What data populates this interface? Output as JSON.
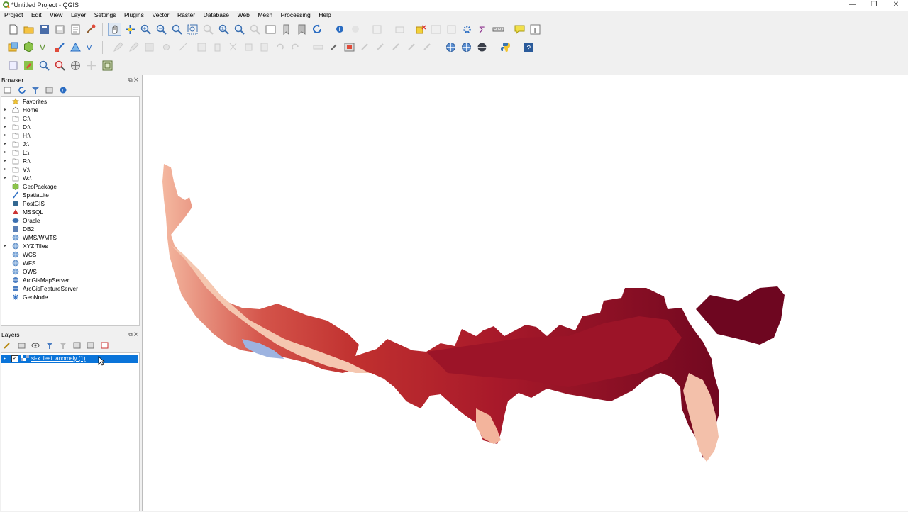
{
  "window": {
    "title": "*Untitled Project - QGIS",
    "minimize": "—",
    "restore": "❐",
    "close": "✕"
  },
  "menu": [
    "Project",
    "Edit",
    "View",
    "Layer",
    "Settings",
    "Plugins",
    "Vector",
    "Raster",
    "Database",
    "Web",
    "Mesh",
    "Processing",
    "Help"
  ],
  "browser": {
    "title": "Browser",
    "items": [
      {
        "label": "Favorites",
        "icon": "star-icon",
        "expand": false
      },
      {
        "label": "Home",
        "icon": "home-icon",
        "expand": true
      },
      {
        "label": "C:\\",
        "icon": "folder-icon",
        "expand": true
      },
      {
        "label": "D:\\",
        "icon": "folder-icon",
        "expand": true
      },
      {
        "label": "H:\\",
        "icon": "folder-icon",
        "expand": true
      },
      {
        "label": "J:\\",
        "icon": "folder-icon",
        "expand": true
      },
      {
        "label": "L:\\",
        "icon": "folder-icon",
        "expand": true
      },
      {
        "label": "R:\\",
        "icon": "folder-icon",
        "expand": true
      },
      {
        "label": "V:\\",
        "icon": "folder-icon",
        "expand": true
      },
      {
        "label": "W:\\",
        "icon": "folder-icon",
        "expand": true
      },
      {
        "label": "GeoPackage",
        "icon": "geopackage-icon",
        "expand": false
      },
      {
        "label": "SpatiaLite",
        "icon": "spatialite-icon",
        "expand": false
      },
      {
        "label": "PostGIS",
        "icon": "postgis-icon",
        "expand": false
      },
      {
        "label": "MSSQL",
        "icon": "mssql-icon",
        "expand": false
      },
      {
        "label": "Oracle",
        "icon": "oracle-icon",
        "expand": false
      },
      {
        "label": "DB2",
        "icon": "db2-icon",
        "expand": false
      },
      {
        "label": "WMS/WMTS",
        "icon": "globe-icon",
        "expand": false
      },
      {
        "label": "XYZ Tiles",
        "icon": "globe-icon",
        "expand": true
      },
      {
        "label": "WCS",
        "icon": "globe-icon",
        "expand": false
      },
      {
        "label": "WFS",
        "icon": "globe-icon",
        "expand": false
      },
      {
        "label": "OWS",
        "icon": "globe-icon",
        "expand": false
      },
      {
        "label": "ArcGisMapServer",
        "icon": "arcgis-icon",
        "expand": false
      },
      {
        "label": "ArcGisFeatureServer",
        "icon": "arcgis-icon",
        "expand": false
      },
      {
        "label": "GeoNode",
        "icon": "geonode-icon",
        "expand": false
      }
    ]
  },
  "layers": {
    "title": "Layers",
    "items": [
      {
        "label": "si-x_leaf_anomaly (1)",
        "checked": "✓",
        "selected": true
      }
    ]
  },
  "colors": {
    "selection": "#0a74d9",
    "map_dark": "#7a0a1f",
    "map_mid": "#b5202b",
    "map_light": "#f2b39c"
  }
}
